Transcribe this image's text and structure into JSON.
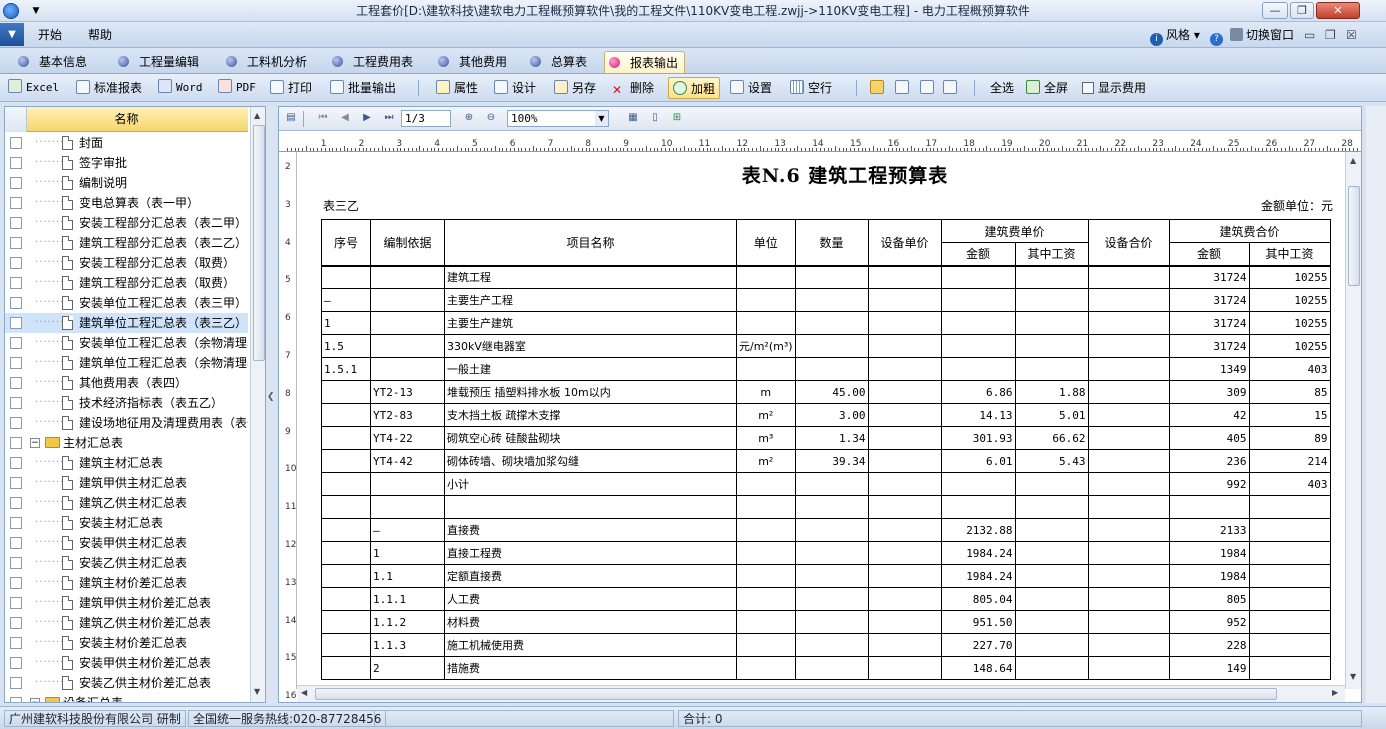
{
  "window": {
    "title": "工程套价[D:\\建软科技\\建软电力工程概预算软件\\我的工程文件\\110KV变电工程.zwjj->110KV变电工程] - 电力工程概预算软件",
    "controls": [
      "—",
      "❐",
      "✕"
    ]
  },
  "menu": {
    "items": [
      "开始",
      "帮助"
    ],
    "right": {
      "style": "风格",
      "help_icon": "?",
      "switch": "切换窗口"
    }
  },
  "tabs": [
    {
      "label": "基本信息"
    },
    {
      "label": "工程量编辑"
    },
    {
      "label": "工料机分析"
    },
    {
      "label": "工程费用表"
    },
    {
      "label": "其他费用"
    },
    {
      "label": "总算表"
    },
    {
      "label": "报表输出",
      "active": true
    }
  ],
  "toolbar": {
    "excel": "Excel",
    "std_report": "标准报表",
    "word": "Word",
    "pdf": "PDF",
    "print": "打印",
    "batch": "批量输出",
    "attr": "属性",
    "design": "设计",
    "save_as": "另存",
    "delete": "删除",
    "bold": "加粗",
    "settings": "设置",
    "blank_row": "空行",
    "select_all": "全选",
    "fullscreen": "全屏",
    "show_fee": "显示费用"
  },
  "tree": {
    "header": "名称",
    "items": [
      {
        "label": "封面",
        "type": "doc"
      },
      {
        "label": "签字审批",
        "type": "doc"
      },
      {
        "label": "编制说明",
        "type": "doc"
      },
      {
        "label": "变电总算表（表一甲）",
        "type": "doc"
      },
      {
        "label": "安装工程部分汇总表（表二甲）",
        "type": "doc"
      },
      {
        "label": "建筑工程部分汇总表（表二乙）",
        "type": "doc"
      },
      {
        "label": "安装工程部分汇总表（取费）",
        "type": "doc"
      },
      {
        "label": "建筑工程部分汇总表（取费）",
        "type": "doc"
      },
      {
        "label": "安装单位工程汇总表（表三甲）",
        "type": "doc"
      },
      {
        "label": "建筑单位工程汇总表（表三乙）",
        "type": "doc",
        "selected": true
      },
      {
        "label": "安装单位工程汇总表（余物清理表",
        "type": "doc"
      },
      {
        "label": "建筑单位工程汇总表（余物清理表",
        "type": "doc"
      },
      {
        "label": "其他费用表（表四）",
        "type": "doc"
      },
      {
        "label": "技术经济指标表（表五乙）",
        "type": "doc"
      },
      {
        "label": "建设场地征用及清理费用表（表七",
        "type": "doc"
      },
      {
        "label": "主材汇总表",
        "type": "folder"
      },
      {
        "label": "建筑主材汇总表",
        "type": "doc"
      },
      {
        "label": "建筑甲供主材汇总表",
        "type": "doc"
      },
      {
        "label": "建筑乙供主材汇总表",
        "type": "doc"
      },
      {
        "label": "安装主材汇总表",
        "type": "doc"
      },
      {
        "label": "安装甲供主材汇总表",
        "type": "doc"
      },
      {
        "label": "安装乙供主材汇总表",
        "type": "doc"
      },
      {
        "label": "建筑主材价差汇总表",
        "type": "doc"
      },
      {
        "label": "建筑甲供主材价差汇总表",
        "type": "doc"
      },
      {
        "label": "建筑乙供主材价差汇总表",
        "type": "doc"
      },
      {
        "label": "安装主材价差汇总表",
        "type": "doc"
      },
      {
        "label": "安装甲供主材价差汇总表",
        "type": "doc"
      },
      {
        "label": "安装乙供主材价差汇总表",
        "type": "doc"
      },
      {
        "label": "设备汇总表",
        "type": "folder"
      }
    ]
  },
  "preview": {
    "page": "1/3",
    "zoom": "100%",
    "ruler_h": [
      "1",
      "2",
      "3",
      "4",
      "5",
      "6",
      "7",
      "8",
      "9",
      "10",
      "11",
      "12",
      "13",
      "14",
      "15",
      "16",
      "17",
      "18",
      "19",
      "20",
      "21",
      "22",
      "23",
      "24",
      "25",
      "26",
      "27",
      "28"
    ],
    "ruler_v": [
      "2",
      "3",
      "4",
      "5",
      "6",
      "7",
      "8",
      "9",
      "10",
      "11",
      "12",
      "13",
      "14",
      "15",
      "16"
    ]
  },
  "report": {
    "title": "表N.6  建筑工程预算表",
    "subtitle": "表三乙",
    "unit": "金额单位：元",
    "headers": {
      "seq": "序号",
      "basis": "编制依据",
      "name": "项目名称",
      "unit": "单位",
      "qty": "数量",
      "equip_price": "设备单价",
      "build_unit": "建筑费单价",
      "amount": "金额",
      "labor": "其中工资",
      "equip_total": "设备合价",
      "build_total": "建筑费合价",
      "amount2": "金额",
      "labor2": "其中工资"
    },
    "rows": [
      [
        "",
        "",
        "建筑工程",
        "",
        "",
        "",
        "",
        "",
        "",
        "31724",
        "10255"
      ],
      [
        "—",
        "",
        "主要生产工程",
        "",
        "",
        "",
        "",
        "",
        "",
        "31724",
        "10255"
      ],
      [
        "1",
        "",
        "主要生产建筑",
        "",
        "",
        "",
        "",
        "",
        "",
        "31724",
        "10255"
      ],
      [
        "1.5",
        "",
        "330kV继电器室",
        "元/m²(m³)",
        "",
        "",
        "",
        "",
        "",
        "31724",
        "10255"
      ],
      [
        "1.5.1",
        "",
        "一般土建",
        "",
        "",
        "",
        "",
        "",
        "",
        "1349",
        "403"
      ],
      [
        "",
        "YT2-13",
        "堆载预压 插塑料排水板 10m以内",
        "m",
        "45.00",
        "",
        "6.86",
        "1.88",
        "",
        "309",
        "85"
      ],
      [
        "",
        "YT2-83",
        "支木挡土板 疏撑木支撑",
        "m²",
        "3.00",
        "",
        "14.13",
        "5.01",
        "",
        "42",
        "15"
      ],
      [
        "",
        "YT4-22",
        "砌筑空心砖 硅酸盐砌块",
        "m³",
        "1.34",
        "",
        "301.93",
        "66.62",
        "",
        "405",
        "89"
      ],
      [
        "",
        "YT4-42",
        "砌体砖墙、砌块墙加浆勾缝",
        "m²",
        "39.34",
        "",
        "6.01",
        "5.43",
        "",
        "236",
        "214"
      ],
      [
        "",
        "",
        "小计",
        "",
        "",
        "",
        "",
        "",
        "",
        "992",
        "403"
      ],
      [
        "",
        "",
        "",
        "",
        "",
        "",
        "",
        "",
        "",
        "",
        ""
      ],
      [
        "",
        "—",
        "直接费",
        "",
        "",
        "",
        "2132.88",
        "",
        "",
        "2133",
        ""
      ],
      [
        "",
        "1",
        "直接工程费",
        "",
        "",
        "",
        "1984.24",
        "",
        "",
        "1984",
        ""
      ],
      [
        "",
        "1.1",
        "定额直接费",
        "",
        "",
        "",
        "1984.24",
        "",
        "",
        "1984",
        ""
      ],
      [
        "",
        "1.1.1",
        "人工费",
        "",
        "",
        "",
        "805.04",
        "",
        "",
        "805",
        ""
      ],
      [
        "",
        "1.1.2",
        "材料费",
        "",
        "",
        "",
        "951.50",
        "",
        "",
        "952",
        ""
      ],
      [
        "",
        "1.1.3",
        "施工机械使用费",
        "",
        "",
        "",
        "227.70",
        "",
        "",
        "228",
        ""
      ],
      [
        "",
        "2",
        "措施费",
        "",
        "",
        "",
        "148.64",
        "",
        "",
        "149",
        ""
      ]
    ]
  },
  "status": {
    "company": "广州建软科技股份有限公司  研制",
    "hotline": "全国统一服务热线:020-87728456",
    "total": "合计: 0"
  },
  "colors": {
    "accent": "#1d4f9a",
    "header_yellow": "#f6d66b",
    "active_tab": "#c8207a"
  }
}
